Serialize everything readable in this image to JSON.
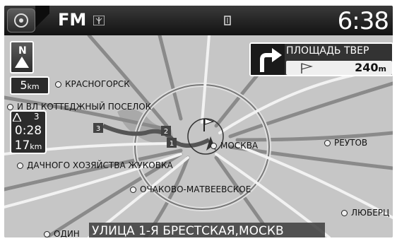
{
  "topbar": {
    "source": "FM",
    "time": "6:38"
  },
  "scale": {
    "value": "5",
    "unit": "km"
  },
  "route_info": {
    "waypoints": "3",
    "eta": "0:28",
    "distance_value": "17",
    "distance_unit": "km"
  },
  "next_turn": {
    "street": "ПЛОЩАДЬ ТВЕР",
    "distance_value": "240",
    "distance_unit": "m"
  },
  "places": {
    "krasnogorsk": "КРАСНОГОРСК",
    "cottage": "И ВЛ КОТТЕДЖНЫЙ ПОСЕЛОК",
    "moscow": "МОСКВА",
    "reutov": "РЕУТОВ",
    "zhukov": "ДАЧНОГО ХОЗЯЙСТВА ЖУКОВКА",
    "ochakovo": "ОЧАКОВО-МАТВЕЕВСКОЕ",
    "lyuberts": "ЛЮБЕРЦ",
    "odintsovo": "ОДИН"
  },
  "waypoint_markers": [
    "1",
    "2",
    "3"
  ],
  "current_street": "УЛИЦА 1-Я БРЕСТСКАЯ,МОСКВ"
}
